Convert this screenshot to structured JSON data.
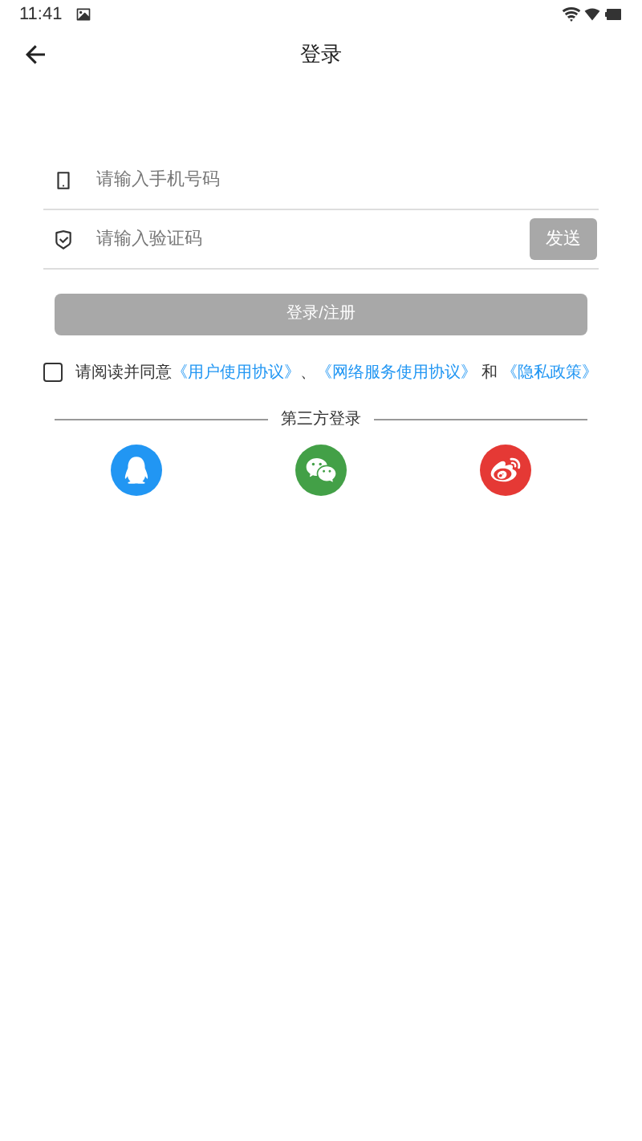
{
  "status_bar": {
    "time": "11:41"
  },
  "header": {
    "title": "登录"
  },
  "fields": [
    {
      "kind": "phone",
      "placeholder": "请输入手机号码"
    },
    {
      "kind": "code",
      "placeholder": "请输入验证码",
      "button": "发送"
    }
  ],
  "login_button": {
    "label": "登录/注册",
    "disabled": true
  },
  "agreement": {
    "checked": false,
    "parts": [
      {
        "kind": "text",
        "text": "请阅读并同意"
      },
      {
        "kind": "link",
        "text": "《用户使用协议》"
      },
      {
        "kind": "text",
        "text": "、"
      },
      {
        "kind": "link",
        "text": "《网络服务使用协议》"
      },
      {
        "kind": "text",
        "text": " 和 "
      },
      {
        "kind": "link",
        "text": "《隐私政策》"
      }
    ]
  },
  "third_party": {
    "title": "第三方登录",
    "providers": [
      {
        "kind": "qq",
        "color": "#2196f3"
      },
      {
        "kind": "wechat",
        "color": "#43a047"
      },
      {
        "kind": "weibo",
        "color": "#e53935"
      }
    ]
  }
}
